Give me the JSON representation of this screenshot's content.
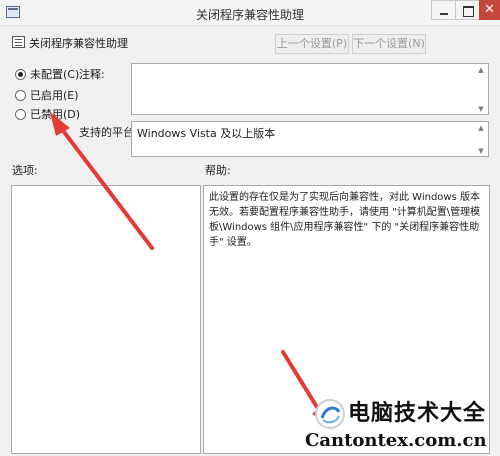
{
  "window": {
    "title": "关闭程序兼容性助理",
    "close_glyph": "✕"
  },
  "header": {
    "policy_title": "关闭程序兼容性助理",
    "prev_label": "上一个设置(P)",
    "next_label": "下一个设置(N)"
  },
  "state": {
    "options": [
      {
        "label": "未配置(C)",
        "checked": true
      },
      {
        "label": "已启用(E)",
        "checked": false
      },
      {
        "label": "已禁用(D)",
        "checked": false
      }
    ]
  },
  "labels": {
    "comment": "注释:",
    "supported_platform": "支持的平台:",
    "options": "选项:",
    "help": "帮助:"
  },
  "comment": {
    "value": ""
  },
  "platform": {
    "value": "Windows Vista 及以上版本"
  },
  "help": {
    "text": "此设置的存在仅是为了实现后向兼容性，对此 Windows 版本无效。若要配置程序兼容性助手，请使用 \"计算机配置\\管理模板\\Windows 组件\\应用程序兼容性\" 下的 \"关闭程序兼容性助手\" 设置。"
  },
  "watermark": {
    "brand": "电脑技术大全",
    "domain": "Cantontex.com.cn"
  },
  "colors": {
    "arrow": "#e53935",
    "close_button": "#c7463a",
    "background": "#f0f0f0"
  }
}
